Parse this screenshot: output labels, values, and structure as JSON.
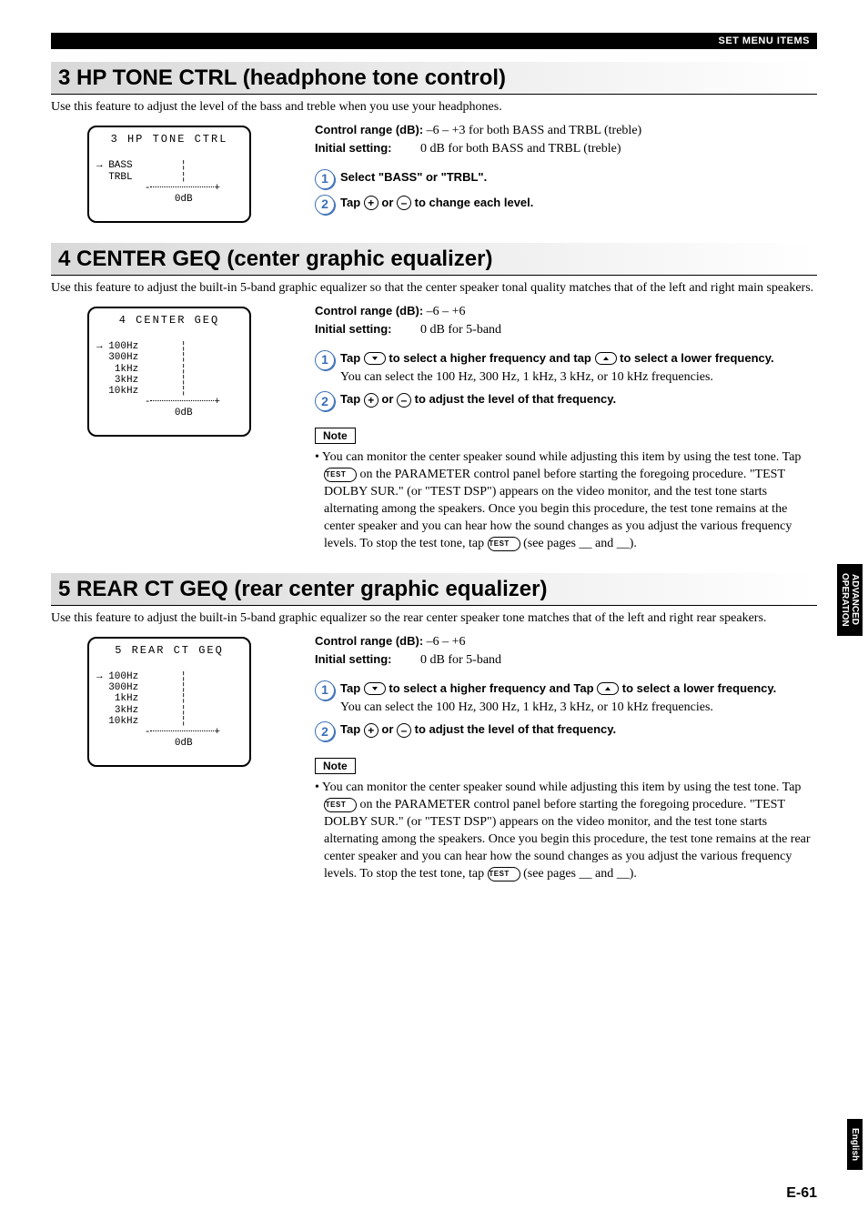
{
  "header": {
    "breadcrumb": "SET MENU ITEMS"
  },
  "sideTabs": {
    "adv_ln1": "ADVANCED",
    "adv_ln2": "OPERATION",
    "lang": "English"
  },
  "pageNum": "E-61",
  "sections": {
    "s3": {
      "title": "3 HP TONE CTRL (headphone tone control)",
      "intro": "Use this feature to adjust the level of the bass and treble when you use your headphones.",
      "lcd": {
        "title": "3 HP TONE CTRL",
        "rows": [
          "BASS",
          "TRBL"
        ],
        "scaleMinus": "-",
        "scalePlus": "+",
        "scaleLabel": "0dB"
      },
      "specs": {
        "range_label": "Control range (dB):",
        "range_value": "–6 – +3 for both BASS and TRBL (treble)",
        "init_label": "Initial setting:",
        "init_value": "0 dB for both BASS and TRBL (treble)"
      },
      "steps": {
        "s1": "Select \"BASS\" or \"TRBL\".",
        "s2_pre": "Tap ",
        "s2_mid": " or ",
        "s2_post": " to change each level."
      }
    },
    "s4": {
      "title": "4 CENTER GEQ (center graphic equalizer)",
      "intro": "Use this feature to adjust the built-in 5-band graphic equalizer so that the center speaker tonal quality matches that of the left and right main speakers.",
      "lcd": {
        "title": "4 CENTER GEQ",
        "rows": [
          "100Hz",
          "300Hz",
          "1kHz",
          "3kHz",
          "10kHz"
        ],
        "scaleMinus": "-",
        "scalePlus": "+",
        "scaleLabel": "0dB"
      },
      "specs": {
        "range_label": "Control range (dB):",
        "range_value": "–6 – +6",
        "init_label": "Initial setting:",
        "init_value": "0 dB for 5-band"
      },
      "steps": {
        "s1_pre": "Tap ",
        "s1_mid": " to select a higher frequency and tap ",
        "s1_post": " to select a lower frequency.",
        "s1_sub": "You can select the 100 Hz, 300 Hz, 1 kHz, 3 kHz, or 10 kHz frequencies.",
        "s2_pre": "Tap ",
        "s2_mid": " or ",
        "s2_post": " to adjust the level of that frequency."
      },
      "note": {
        "label": "Note",
        "bullet_pre": "• You can monitor the center speaker sound while adjusting this item by using the test tone. Tap ",
        "bullet_mid1": " on the PARAMETER control panel before starting the foregoing procedure. \"TEST DOLBY SUR.\" (or \"TEST DSP\") appears on the video monitor, and the test tone starts alternating among the speakers. Once you begin this procedure, the test tone remains at the center speaker and you can hear how the sound changes as you adjust the various frequency levels. To stop the test tone, tap ",
        "bullet_post": " (see pages __ and __)."
      }
    },
    "s5": {
      "title": "5 REAR CT GEQ (rear center graphic equalizer)",
      "intro": "Use this feature to adjust the built-in 5-band graphic equalizer so the rear center speaker tone matches that of the left and right rear speakers.",
      "lcd": {
        "title": "5 REAR CT GEQ",
        "rows": [
          "100Hz",
          "300Hz",
          "1kHz",
          "3kHz",
          "10kHz"
        ],
        "scaleMinus": "-",
        "scalePlus": "+",
        "scaleLabel": "0dB"
      },
      "specs": {
        "range_label": "Control range (dB):",
        "range_value": "–6 – +6",
        "init_label": "Initial setting:",
        "init_value": "0 dB for 5-band"
      },
      "steps": {
        "s1_pre": "Tap ",
        "s1_mid": " to select a higher frequency and Tap ",
        "s1_post": " to select a lower frequency.",
        "s1_sub": "You can select the 100 Hz, 300 Hz, 1 kHz, 3 kHz, or 10 kHz frequencies.",
        "s2_pre": "Tap ",
        "s2_mid": " or ",
        "s2_post": " to adjust the level of that frequency."
      },
      "note": {
        "label": "Note",
        "bullet_pre": "• You can monitor the center speaker sound while adjusting this item by using the test tone. Tap ",
        "bullet_mid1": " on the PARAMETER control panel before starting the foregoing procedure. \"TEST DOLBY SUR.\" (or \"TEST DSP\") appears on the video monitor, and the test tone starts alternating among the speakers. Once you begin this procedure, the test tone remains at the rear center speaker and you can hear how the sound changes as you adjust the various frequency levels. To stop the test tone, tap ",
        "bullet_post": " (see pages __ and __)."
      }
    }
  },
  "icons": {
    "plus": "+",
    "minus": "–",
    "test": "TEST"
  }
}
